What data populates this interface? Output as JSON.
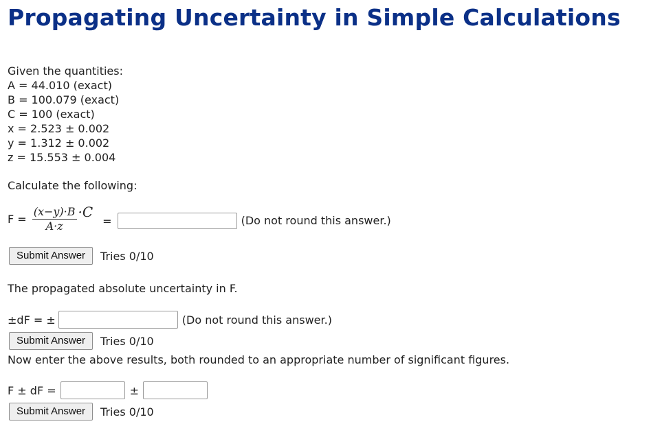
{
  "title": "Propagating Uncertainty in Simple Calculations",
  "given_label": "Given the quantities:",
  "quantities": [
    "A = 44.010 (exact)",
    "B = 100.079 (exact)",
    "C = 100 (exact)",
    "x = 2.523 ± 0.002",
    "y = 1.312 ± 0.002",
    "z = 15.553 ± 0.004"
  ],
  "calculate_label": "Calculate the following:",
  "formula": {
    "lhs": "F =",
    "numerator": "(x−y)·B",
    "denominator": "A·z",
    "multiplier": "·C",
    "equals": "="
  },
  "q1": {
    "value": "",
    "note": "(Do not round this answer.)",
    "button": "Submit Answer",
    "tries": "Tries 0/10"
  },
  "q2": {
    "prompt": "The propagated absolute uncertainty in F.",
    "label": "±dF = ±",
    "value": "",
    "note": "(Do not round this answer.)",
    "button": "Submit Answer",
    "tries": "Tries 0/10"
  },
  "q3": {
    "prompt": "Now enter the above results, both rounded to an appropriate number of significant figures.",
    "label": "F ± dF =",
    "pm": "±",
    "value_f": "",
    "value_df": "",
    "button": "Submit Answer",
    "tries": "Tries 0/10"
  }
}
